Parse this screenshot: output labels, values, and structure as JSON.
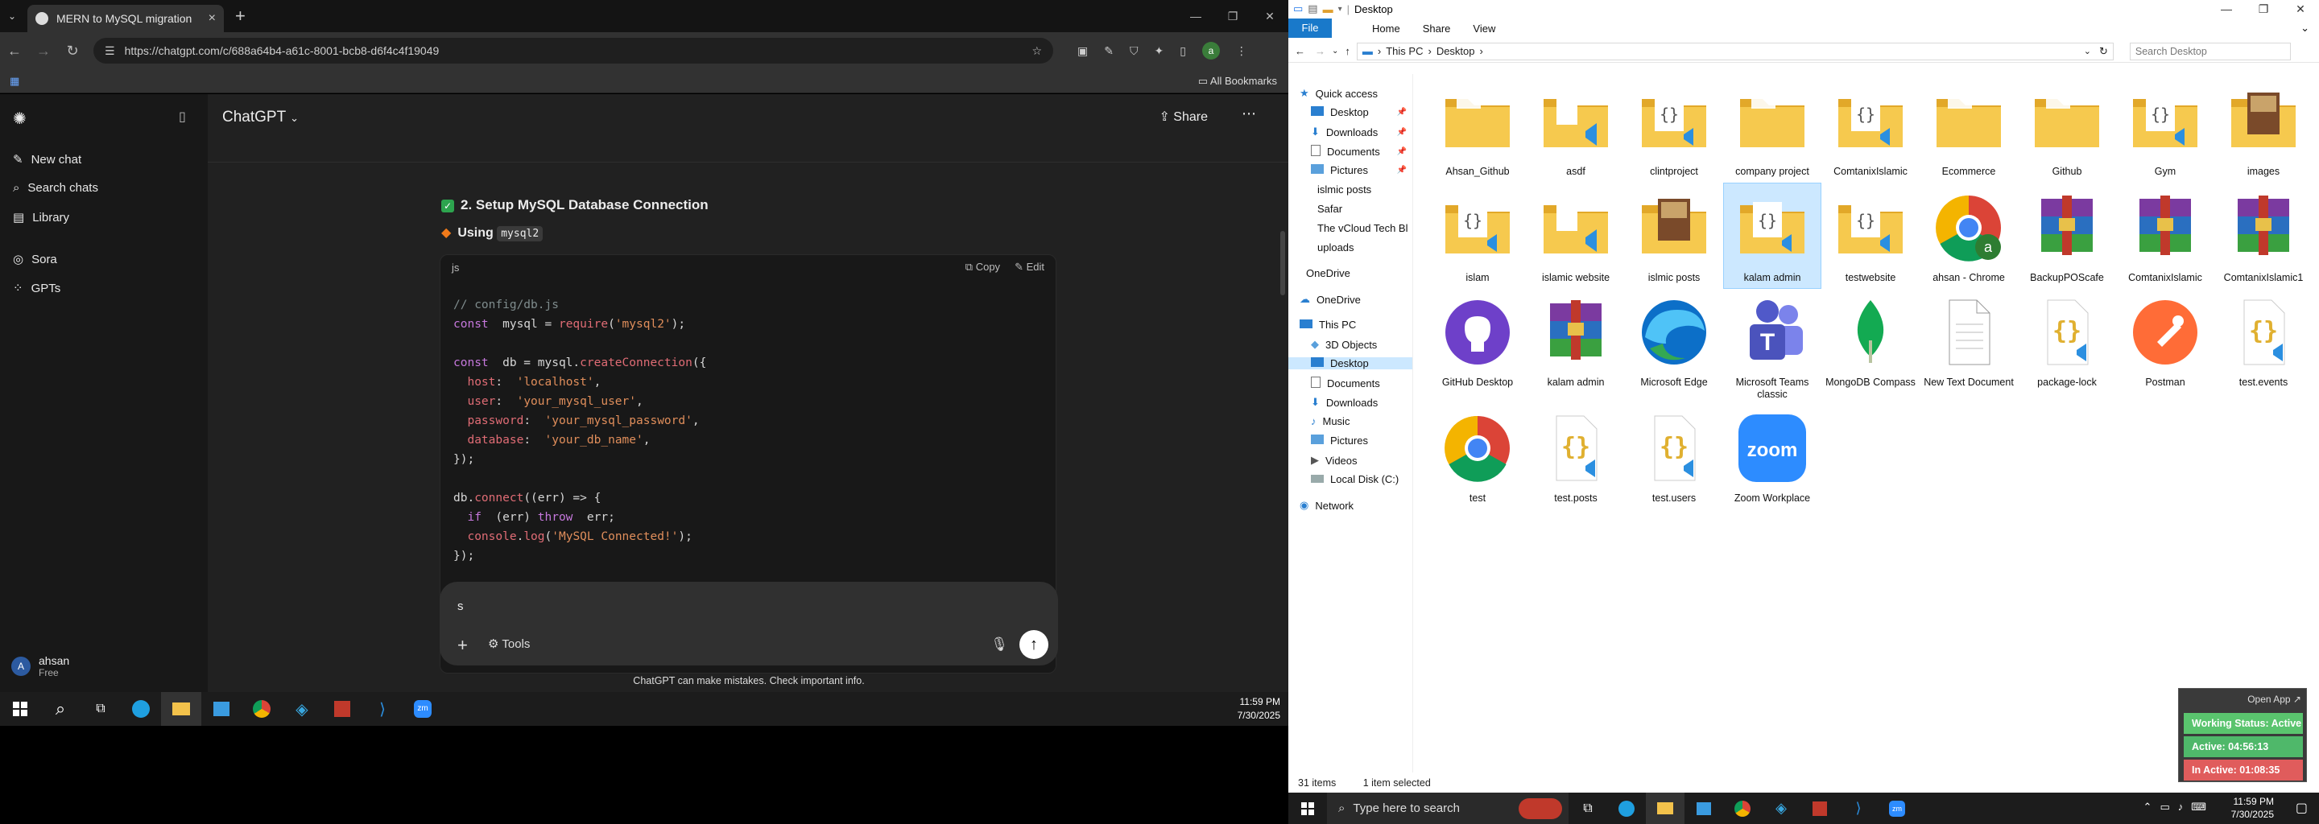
{
  "chrome": {
    "tab_title": "MERN to MySQL migration",
    "url": "https://chatgpt.com/c/688a64b4-a61c-8001-bcb8-d6f4c4f19049",
    "all_bookmarks": "All Bookmarks",
    "profile_initial": "a"
  },
  "chatgpt": {
    "sidebar": {
      "new_chat": "New chat",
      "search": "Search chats",
      "library": "Library",
      "sora": "Sora",
      "gpts": "GPTs"
    },
    "model": "ChatGPT",
    "share": "Share",
    "section_title": "2. Setup MySQL Database Connection",
    "using_label": "Using",
    "using_code": "mysql2",
    "code_lang": "js",
    "copy": "Copy",
    "edit": "Edit",
    "code_lines": [
      [
        [
          "c-com",
          "// config/db.js"
        ]
      ],
      [
        [
          "c-kw",
          "const"
        ],
        [
          "",
          "  mysql = "
        ],
        [
          "c-fn",
          "require"
        ],
        [
          "",
          "("
        ],
        [
          "c-str",
          "'mysql2'"
        ],
        [
          "",
          ");"
        ]
      ],
      [
        [
          "",
          ""
        ]
      ],
      [
        [
          "c-kw",
          "const"
        ],
        [
          "",
          "  db = mysql."
        ],
        [
          "c-fn",
          "createConnection"
        ],
        [
          "",
          "({"
        ]
      ],
      [
        [
          "c-prop",
          "  host"
        ],
        [
          "",
          ":  "
        ],
        [
          "c-str",
          "'localhost'"
        ],
        [
          "",
          ","
        ]
      ],
      [
        [
          "c-prop",
          "  user"
        ],
        [
          "",
          ":  "
        ],
        [
          "c-str",
          "'your_mysql_user'"
        ],
        [
          "",
          ","
        ]
      ],
      [
        [
          "c-prop",
          "  password"
        ],
        [
          "",
          ":  "
        ],
        [
          "c-str",
          "'your_mysql_password'"
        ],
        [
          "",
          ","
        ]
      ],
      [
        [
          "c-prop",
          "  database"
        ],
        [
          "",
          ":  "
        ],
        [
          "c-str",
          "'your_db_name'"
        ],
        [
          "",
          ","
        ]
      ],
      [
        [
          "",
          "});"
        ]
      ],
      [
        [
          "",
          ""
        ]
      ],
      [
        [
          "",
          "db."
        ],
        [
          "c-fn",
          "connect"
        ],
        [
          "",
          "((err) => {"
        ]
      ],
      [
        [
          "c-kw",
          "  if"
        ],
        [
          "",
          "  (err) "
        ],
        [
          "c-kw",
          "throw"
        ],
        [
          "",
          "  err;"
        ]
      ],
      [
        [
          "c-fn",
          "  console"
        ],
        [
          "",
          "."
        ],
        [
          "c-fn",
          "log"
        ],
        [
          "",
          "("
        ],
        [
          "c-str",
          "'MySQL Connected!'"
        ],
        [
          "",
          ");"
        ]
      ],
      [
        [
          "",
          "});"
        ]
      ]
    ],
    "composer_value": "s",
    "tools": "Tools",
    "disclaimer": "ChatGPT can make mistakes. Check important info.",
    "user": {
      "initial": "A",
      "name": "ahsan",
      "plan": "Free"
    }
  },
  "taskbar1": {
    "time": "11:59 PM",
    "date": "7/30/2025"
  },
  "explorer": {
    "title": "Desktop",
    "ribbon": [
      "File",
      "Home",
      "Share",
      "View"
    ],
    "breadcrumb": [
      "This PC",
      "Desktop"
    ],
    "search_placeholder": "Search Desktop",
    "nav": [
      {
        "label": "Quick access",
        "kind": "star"
      },
      {
        "label": "Desktop",
        "kind": "desk",
        "pin": true
      },
      {
        "label": "Downloads",
        "kind": "down",
        "pin": true
      },
      {
        "label": "Documents",
        "kind": "docs",
        "pin": true
      },
      {
        "label": "Pictures",
        "kind": "pics",
        "pin": true
      },
      {
        "label": "islmic posts",
        "kind": "folder"
      },
      {
        "label": "Safar",
        "kind": "folder"
      },
      {
        "label": "The vCloud Tech Bl",
        "kind": "folder"
      },
      {
        "label": "uploads",
        "kind": "folder"
      },
      {
        "label": "OneDrive",
        "kind": "folder"
      },
      {
        "label": "OneDrive",
        "kind": "cloud"
      },
      {
        "label": "This PC",
        "kind": "pc"
      },
      {
        "label": "3D Objects",
        "kind": "cube"
      },
      {
        "label": "Desktop",
        "kind": "desk",
        "selected": true
      },
      {
        "label": "Documents",
        "kind": "docs"
      },
      {
        "label": "Downloads",
        "kind": "down"
      },
      {
        "label": "Music",
        "kind": "music"
      },
      {
        "label": "Pictures",
        "kind": "pics"
      },
      {
        "label": "Videos",
        "kind": "video"
      },
      {
        "label": "Local Disk (C:)",
        "kind": "disk"
      },
      {
        "label": "Network",
        "kind": "net"
      }
    ],
    "items": [
      {
        "label": "Ahsan_Github",
        "kind": "folder"
      },
      {
        "label": "asdf",
        "kind": "folder-vs"
      },
      {
        "label": "clintproject",
        "kind": "folder-code"
      },
      {
        "label": "company project",
        "kind": "folder"
      },
      {
        "label": "ComtanixIslamic",
        "kind": "folder-code"
      },
      {
        "label": "Ecommerce",
        "kind": "folder"
      },
      {
        "label": "Github",
        "kind": "folder"
      },
      {
        "label": "Gym",
        "kind": "folder-code"
      },
      {
        "label": "images",
        "kind": "folder-img"
      },
      {
        "label": "islam",
        "kind": "folder-code"
      },
      {
        "label": "islamic website",
        "kind": "folder-vs"
      },
      {
        "label": "islmic posts",
        "kind": "folder-img"
      },
      {
        "label": "kalam admin",
        "kind": "folder-code",
        "selected": true
      },
      {
        "label": "testwebsite",
        "kind": "folder-code"
      },
      {
        "label": "ahsan - Chrome",
        "kind": "chrome-a"
      },
      {
        "label": "BackupPOScafe",
        "kind": "rar"
      },
      {
        "label": "ComtanixIslamic",
        "kind": "rar"
      },
      {
        "label": "ComtanixIslamic1",
        "kind": "rar"
      },
      {
        "label": "GitHub Desktop",
        "kind": "github"
      },
      {
        "label": "kalam admin",
        "kind": "rar"
      },
      {
        "label": "Microsoft Edge",
        "kind": "edge"
      },
      {
        "label": "Microsoft Teams classic",
        "kind": "teams"
      },
      {
        "label": "MongoDB Compass",
        "kind": "mongo"
      },
      {
        "label": "New Text Document",
        "kind": "txt"
      },
      {
        "label": "package-lock",
        "kind": "json"
      },
      {
        "label": "Postman",
        "kind": "postman"
      },
      {
        "label": "test.events",
        "kind": "json"
      },
      {
        "label": "test",
        "kind": "chrome"
      },
      {
        "label": "test.posts",
        "kind": "json"
      },
      {
        "label": "test.users",
        "kind": "json"
      },
      {
        "label": "Zoom Workplace",
        "kind": "zoom"
      }
    ],
    "status_count": "31 items",
    "status_selected": "1 item selected"
  },
  "widget": {
    "open_app": "Open App ↗",
    "working": "Working Status: Active",
    "active": "Active: 04:56:13",
    "inactive": "In Active: 01:08:35"
  },
  "taskbar2": {
    "search_placeholder": "Type here to search",
    "time": "11:59 PM",
    "date": "7/30/2025"
  },
  "colors": {
    "folder": "#f3c24b",
    "selection": "#cce8ff",
    "accent_blue": "#1979ca",
    "active_green": "#4fb86a",
    "inactive_red": "#e05c5c"
  }
}
